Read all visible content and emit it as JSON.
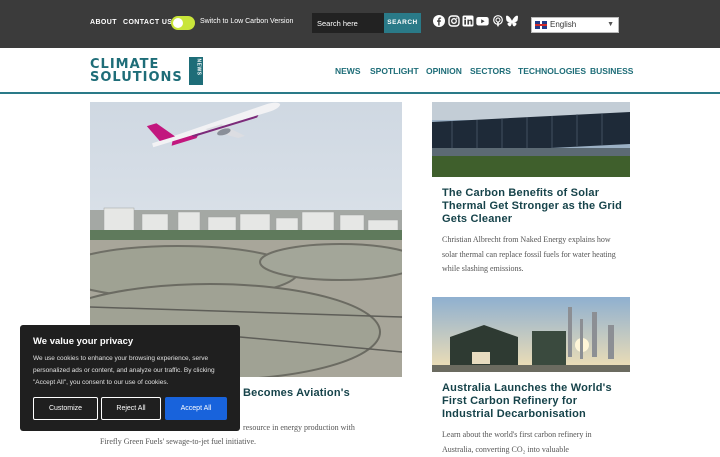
{
  "topbar": {
    "about": "ABOUT",
    "contact": "CONTACT US",
    "toggle_label": "Switch to Low Carbon Version",
    "search_placeholder": "Search here",
    "search_button": "SEARCH",
    "social_icons": [
      "facebook-icon",
      "instagram-icon",
      "linkedin-icon",
      "youtube-icon",
      "podcast-icon",
      "bluesky-icon"
    ],
    "language": "English"
  },
  "header": {
    "logo_line1": "CLIMATE",
    "logo_line2": "SOLUTIONS",
    "logo_box": "NEWS",
    "nav": [
      "NEWS",
      "SPOTLIGHT",
      "OPINION",
      "SECTORS",
      "TECHNOLOGIES",
      "BUSINESS"
    ]
  },
  "articles": {
    "hero": {
      "title_visible": "Becomes Aviation's",
      "excerpt": "Firefly Green Fuels' sewage-to-jet fuel initiative.",
      "excerpt_partial": "resource in energy production with"
    },
    "second": {
      "title": "The Carbon Benefits of Solar Thermal Get Stronger as the Grid Gets Cleaner",
      "excerpt": "Christian Albrecht from Naked Energy explains how solar thermal can replace fossil fuels for water heating while slashing emissions."
    },
    "third": {
      "title": "Australia Launches the World's First Carbon Refinery for Industrial Decarbonisation",
      "excerpt": "Learn about the world's first carbon refinery in Australia, converting CO₂ into valuable"
    }
  },
  "cookie": {
    "title": "We value your privacy",
    "text": "We use cookies to enhance your browsing experience, serve personalized ads or content, and analyze our traffic. By clicking \"Accept All\", you consent to our use of cookies.",
    "customize": "Customize",
    "reject": "Reject All",
    "accept": "Accept All"
  },
  "colors": {
    "brand": "#1e6d78",
    "topbar": "#3b3b3b",
    "toggle": "#c9e53a",
    "accept": "#1863dc"
  }
}
